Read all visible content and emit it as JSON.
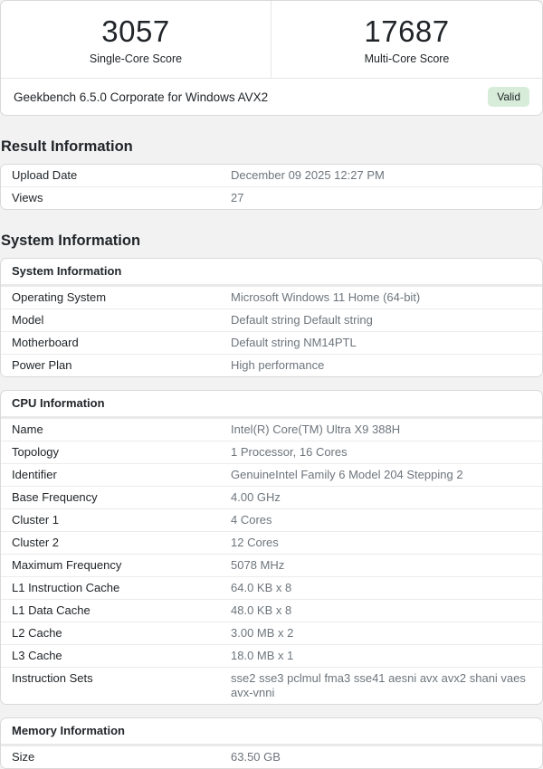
{
  "scores": {
    "single": {
      "value": "3057",
      "label": "Single-Core Score"
    },
    "multi": {
      "value": "17687",
      "label": "Multi-Core Score"
    }
  },
  "version_bar": {
    "text": "Geekbench 6.5.0 Corporate for Windows AVX2",
    "badge": "Valid"
  },
  "sections": {
    "result": {
      "heading": "Result Information",
      "rows": [
        {
          "label": "Upload Date",
          "value": "December 09 2025 12:27 PM"
        },
        {
          "label": "Views",
          "value": "27"
        }
      ]
    },
    "system": {
      "heading": "System Information",
      "cards": [
        {
          "header": "System Information",
          "rows": [
            {
              "label": "Operating System",
              "value": "Microsoft Windows 11 Home (64-bit)"
            },
            {
              "label": "Model",
              "value": "Default string Default string"
            },
            {
              "label": "Motherboard",
              "value": "Default string NM14PTL"
            },
            {
              "label": "Power Plan",
              "value": "High performance"
            }
          ]
        },
        {
          "header": "CPU Information",
          "rows": [
            {
              "label": "Name",
              "value": "Intel(R) Core(TM) Ultra X9 388H"
            },
            {
              "label": "Topology",
              "value": "1 Processor, 16 Cores"
            },
            {
              "label": "Identifier",
              "value": "GenuineIntel Family 6 Model 204 Stepping 2"
            },
            {
              "label": "Base Frequency",
              "value": "4.00 GHz"
            },
            {
              "label": "Cluster 1",
              "value": "4 Cores"
            },
            {
              "label": "Cluster 2",
              "value": "12 Cores"
            },
            {
              "label": "Maximum Frequency",
              "value": "5078 MHz"
            },
            {
              "label": "L1 Instruction Cache",
              "value": "64.0 KB x 8"
            },
            {
              "label": "L1 Data Cache",
              "value": "48.0 KB x 8"
            },
            {
              "label": "L2 Cache",
              "value": "3.00 MB x 2"
            },
            {
              "label": "L3 Cache",
              "value": "18.0 MB x 1"
            },
            {
              "label": "Instruction Sets",
              "value": "sse2 sse3 pclmul fma3 sse41 aesni avx avx2 shani vaes avx-vnni"
            }
          ]
        },
        {
          "header": "Memory Information",
          "rows": [
            {
              "label": "Size",
              "value": "63.50 GB"
            }
          ]
        }
      ]
    }
  },
  "colors": {
    "page_bg": "#f2f2f2",
    "card_border": "#d9d9d9",
    "badge_bg": "#d7ecd9",
    "badge_text": "#212529",
    "label_text": "#212529",
    "value_text": "#6d757c"
  }
}
